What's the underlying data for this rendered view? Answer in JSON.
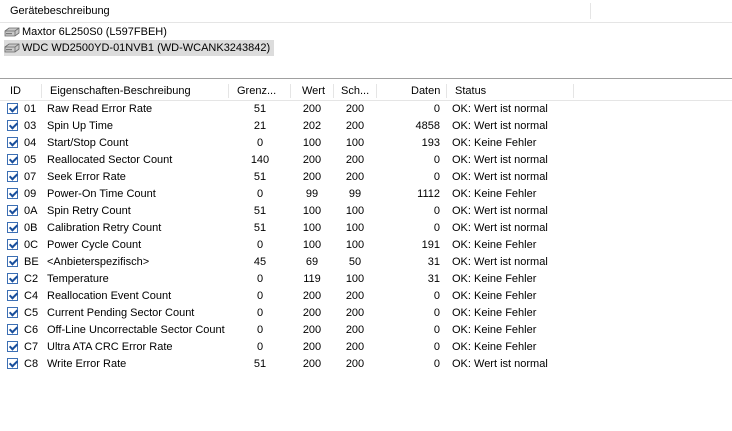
{
  "device_panel": {
    "header": "Gerätebeschreibung",
    "devices": [
      {
        "label": "Maxtor 6L250S0 (L597FBEH)",
        "icon": "hard-drive-icon",
        "selected": false
      },
      {
        "label": "WDC WD2500YD-01NVB1 (WD-WCANK3243842)",
        "icon": "hard-drive-icon",
        "selected": true
      }
    ]
  },
  "table": {
    "columns": [
      "ID",
      "Eigenschaften-Beschreibung",
      "Grenz...",
      "Wert",
      "Sch...",
      "Daten",
      "Status"
    ],
    "rows": [
      {
        "id": "01",
        "desc": "Raw Read Error Rate",
        "grenz": "51",
        "wert": "200",
        "sch": "200",
        "daten": "0",
        "status": "OK: Wert ist normal",
        "checked": true
      },
      {
        "id": "03",
        "desc": "Spin Up Time",
        "grenz": "21",
        "wert": "202",
        "sch": "200",
        "daten": "4858",
        "status": "OK: Wert ist normal",
        "checked": true
      },
      {
        "id": "04",
        "desc": "Start/Stop Count",
        "grenz": "0",
        "wert": "100",
        "sch": "100",
        "daten": "193",
        "status": "OK: Keine Fehler",
        "checked": true
      },
      {
        "id": "05",
        "desc": "Reallocated Sector Count",
        "grenz": "140",
        "wert": "200",
        "sch": "200",
        "daten": "0",
        "status": "OK: Wert ist normal",
        "checked": true
      },
      {
        "id": "07",
        "desc": "Seek Error Rate",
        "grenz": "51",
        "wert": "200",
        "sch": "200",
        "daten": "0",
        "status": "OK: Wert ist normal",
        "checked": true
      },
      {
        "id": "09",
        "desc": "Power-On Time Count",
        "grenz": "0",
        "wert": "99",
        "sch": "99",
        "daten": "1112",
        "status": "OK: Keine Fehler",
        "checked": true
      },
      {
        "id": "0A",
        "desc": "Spin Retry Count",
        "grenz": "51",
        "wert": "100",
        "sch": "100",
        "daten": "0",
        "status": "OK: Wert ist normal",
        "checked": true
      },
      {
        "id": "0B",
        "desc": "Calibration Retry Count",
        "grenz": "51",
        "wert": "100",
        "sch": "100",
        "daten": "0",
        "status": "OK: Wert ist normal",
        "checked": true
      },
      {
        "id": "0C",
        "desc": "Power Cycle Count",
        "grenz": "0",
        "wert": "100",
        "sch": "100",
        "daten": "191",
        "status": "OK: Keine Fehler",
        "checked": true
      },
      {
        "id": "BE",
        "desc": "<Anbieterspezifisch>",
        "grenz": "45",
        "wert": "69",
        "sch": "50",
        "daten": "31",
        "status": "OK: Wert ist normal",
        "checked": true
      },
      {
        "id": "C2",
        "desc": "Temperature",
        "grenz": "0",
        "wert": "119",
        "sch": "100",
        "daten": "31",
        "status": "OK: Keine Fehler",
        "checked": true
      },
      {
        "id": "C4",
        "desc": "Reallocation Event Count",
        "grenz": "0",
        "wert": "200",
        "sch": "200",
        "daten": "0",
        "status": "OK: Keine Fehler",
        "checked": true
      },
      {
        "id": "C5",
        "desc": "Current Pending Sector Count",
        "grenz": "0",
        "wert": "200",
        "sch": "200",
        "daten": "0",
        "status": "OK: Keine Fehler",
        "checked": true
      },
      {
        "id": "C6",
        "desc": "Off-Line Uncorrectable Sector Count",
        "grenz": "0",
        "wert": "200",
        "sch": "200",
        "daten": "0",
        "status": "OK: Keine Fehler",
        "checked": true
      },
      {
        "id": "C7",
        "desc": "Ultra ATA CRC Error Rate",
        "grenz": "0",
        "wert": "200",
        "sch": "200",
        "daten": "0",
        "status": "OK: Keine Fehler",
        "checked": true
      },
      {
        "id": "C8",
        "desc": "Write Error Rate",
        "grenz": "51",
        "wert": "200",
        "sch": "200",
        "daten": "0",
        "status": "OK: Wert ist normal",
        "checked": true
      }
    ]
  }
}
